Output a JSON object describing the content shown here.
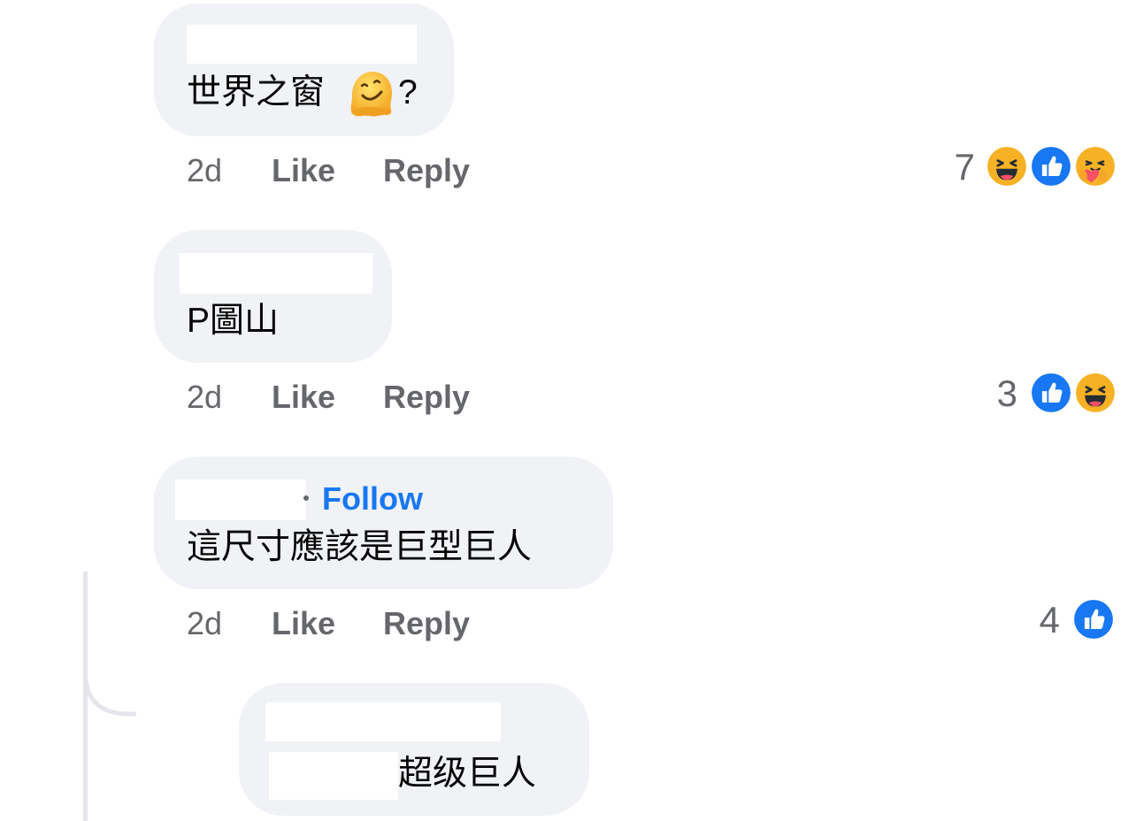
{
  "comments": [
    {
      "text": "世界之窗",
      "text_suffix": "?",
      "inline_emoji": "melting-face-emoji",
      "time": "2d",
      "like_label": "Like",
      "reply_label": "Reply",
      "reaction_count": "7",
      "reactions": [
        "haha-reaction-icon",
        "like-reaction-icon",
        "care-reaction-icon"
      ]
    },
    {
      "text": "P圖山",
      "time": "2d",
      "like_label": "Like",
      "reply_label": "Reply",
      "reaction_count": "3",
      "reactions": [
        "like-reaction-icon",
        "haha-reaction-icon"
      ]
    },
    {
      "follow_label": "Follow",
      "text": "這尺寸應該是巨型巨人",
      "time": "2d",
      "like_label": "Like",
      "reply_label": "Reply",
      "reaction_count": "4",
      "reactions": [
        "like-reaction-icon"
      ]
    }
  ],
  "reply": {
    "text": "超级巨人"
  },
  "colors": {
    "bubble": "#f0f2f5",
    "meta_text": "#65676b",
    "follow_blue": "#1877f2",
    "like_blue": "#1877f2",
    "haha_yellow": "#f7b125"
  }
}
